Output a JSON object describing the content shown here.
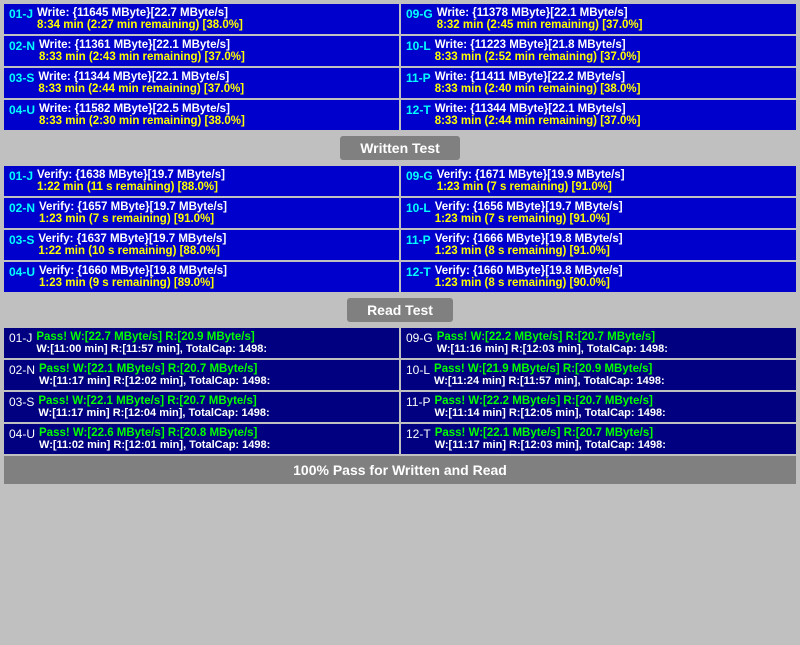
{
  "sections": {
    "write": {
      "label": "Written Test",
      "rows": [
        {
          "id": "01-J",
          "line1": "Write: {11645 MByte}[22.7 MByte/s]",
          "line2": "8:34 min (2:27 min remaining)  [38.0%]"
        },
        {
          "id": "09-G",
          "line1": "Write: {11378 MByte}[22.1 MByte/s]",
          "line2": "8:32 min (2:45 min remaining)  [37.0%]"
        },
        {
          "id": "02-N",
          "line1": "Write: {11361 MByte}[22.1 MByte/s]",
          "line2": "8:33 min (2:43 min remaining)  [37.0%]"
        },
        {
          "id": "10-L",
          "line1": "Write: {11223 MByte}[21.8 MByte/s]",
          "line2": "8:33 min (2:52 min remaining)  [37.0%]"
        },
        {
          "id": "03-S",
          "line1": "Write: {11344 MByte}[22.1 MByte/s]",
          "line2": "8:33 min (2:44 min remaining)  [37.0%]"
        },
        {
          "id": "11-P",
          "line1": "Write: {11411 MByte}[22.2 MByte/s]",
          "line2": "8:33 min (2:40 min remaining)  [38.0%]"
        },
        {
          "id": "04-U",
          "line1": "Write: {11582 MByte}[22.5 MByte/s]",
          "line2": "8:33 min (2:30 min remaining)  [38.0%]"
        },
        {
          "id": "12-T",
          "line1": "Write: {11344 MByte}[22.1 MByte/s]",
          "line2": "8:33 min (2:44 min remaining)  [37.0%]"
        }
      ]
    },
    "verify": {
      "label": "Written Test",
      "rows": [
        {
          "id": "01-J",
          "line1": "Verify: {1638 MByte}[19.7 MByte/s]",
          "line2": "1:22 min (11 s remaining)   [88.0%]"
        },
        {
          "id": "09-G",
          "line1": "Verify: {1671 MByte}[19.9 MByte/s]",
          "line2": "1:23 min (7 s remaining)   [91.0%]"
        },
        {
          "id": "02-N",
          "line1": "Verify: {1657 MByte}[19.7 MByte/s]",
          "line2": "1:23 min (7 s remaining)   [91.0%]"
        },
        {
          "id": "10-L",
          "line1": "Verify: {1656 MByte}[19.7 MByte/s]",
          "line2": "1:23 min (7 s remaining)   [91.0%]"
        },
        {
          "id": "03-S",
          "line1": "Verify: {1637 MByte}[19.7 MByte/s]",
          "line2": "1:22 min (10 s remaining)   [88.0%]"
        },
        {
          "id": "11-P",
          "line1": "Verify: {1666 MByte}[19.8 MByte/s]",
          "line2": "1:23 min (8 s remaining)   [91.0%]"
        },
        {
          "id": "04-U",
          "line1": "Verify: {1660 MByte}[19.8 MByte/s]",
          "line2": "1:23 min (9 s remaining)   [89.0%]"
        },
        {
          "id": "12-T",
          "line1": "Verify: {1660 MByte}[19.8 MByte/s]",
          "line2": "1:23 min (8 s remaining)   [90.0%]"
        }
      ]
    },
    "read": {
      "label": "Read Test",
      "rows": [
        {
          "id": "01-J",
          "line1": "Pass! W:[22.7 MByte/s] R:[20.9 MByte/s]",
          "line2": "W:[11:00 min] R:[11:57 min], TotalCap: 1498:"
        },
        {
          "id": "09-G",
          "line1": "Pass! W:[22.2 MByte/s] R:[20.7 MByte/s]",
          "line2": "W:[11:16 min] R:[12:03 min], TotalCap: 1498:"
        },
        {
          "id": "02-N",
          "line1": "Pass! W:[22.1 MByte/s] R:[20.7 MByte/s]",
          "line2": "W:[11:17 min] R:[12:02 min], TotalCap: 1498:"
        },
        {
          "id": "10-L",
          "line1": "Pass! W:[21.9 MByte/s] R:[20.9 MByte/s]",
          "line2": "W:[11:24 min] R:[11:57 min], TotalCap: 1498:"
        },
        {
          "id": "03-S",
          "line1": "Pass! W:[22.1 MByte/s] R:[20.7 MByte/s]",
          "line2": "W:[11:17 min] R:[12:04 min], TotalCap: 1498:"
        },
        {
          "id": "11-P",
          "line1": "Pass! W:[22.2 MByte/s] R:[20.7 MByte/s]",
          "line2": "W:[11:14 min] R:[12:05 min], TotalCap: 1498:"
        },
        {
          "id": "04-U",
          "line1": "Pass! W:[22.6 MByte/s] R:[20.8 MByte/s]",
          "line2": "W:[11:02 min] R:[12:01 min], TotalCap: 1498:"
        },
        {
          "id": "12-T",
          "line1": "Pass! W:[22.1 MByte/s] R:[20.7 MByte/s]",
          "line2": "W:[11:17 min] R:[12:03 min], TotalCap: 1498:"
        }
      ]
    }
  },
  "labels": {
    "written_test": "Written Test",
    "read_test": "Read Test",
    "bottom_bar": "100% Pass for Written and Read"
  }
}
